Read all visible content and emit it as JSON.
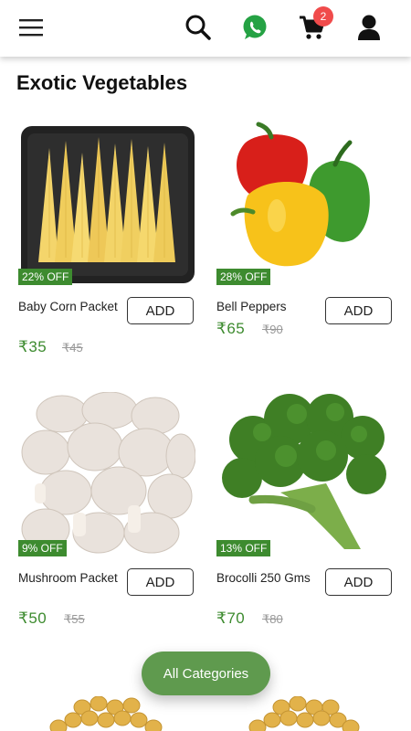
{
  "header": {
    "icons": [
      "hamburger-menu-icon",
      "search-icon",
      "whatsapp-icon",
      "cart-icon",
      "user-icon"
    ],
    "cart_count": "2"
  },
  "section": {
    "title": "Exotic Vegetables"
  },
  "products": [
    {
      "name": "Baby Corn Packet",
      "discount": "22% OFF",
      "price": "₹35",
      "mrp": "₹45",
      "add_label": "ADD"
    },
    {
      "name": "Bell Peppers",
      "discount": "28% OFF",
      "price": "₹65",
      "mrp": "₹90",
      "add_label": "ADD"
    },
    {
      "name": "Mushroom Packet",
      "discount": "9% OFF",
      "price": "₹50",
      "mrp": "₹55",
      "add_label": "ADD"
    },
    {
      "name": "Brocolli 250 Gms",
      "discount": "13% OFF",
      "price": "₹70",
      "mrp": "₹80",
      "add_label": "ADD"
    }
  ],
  "fab": {
    "label": "All Categories"
  },
  "colors": {
    "accent_green": "#3d8b2f",
    "badge_red": "#f04b4b",
    "whatsapp_green": "#25a244"
  }
}
